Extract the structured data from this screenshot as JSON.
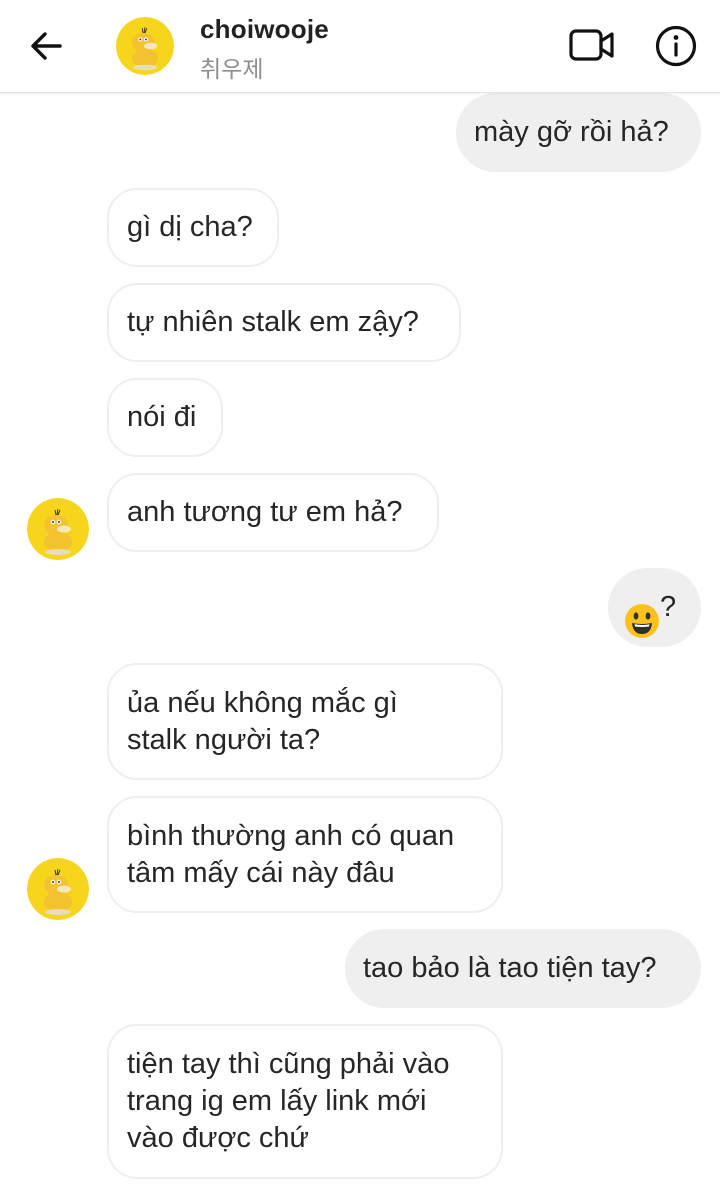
{
  "header": {
    "title": "choiwooje",
    "subtitle": "취우제",
    "back_icon": "arrow-left-icon",
    "video_icon": "video-camera-icon",
    "info_icon": "info-icon"
  },
  "messages": [
    {
      "side": "sent",
      "text": "mày gỡ rồi hả?"
    },
    {
      "side": "received",
      "text": "gì dị cha?"
    },
    {
      "side": "received",
      "text": "tự nhiên stalk em zậy?"
    },
    {
      "side": "received",
      "text": "nói đi"
    },
    {
      "side": "received",
      "text": "anh tương tư em hả?"
    },
    {
      "side": "sent",
      "emoji": "😃",
      "text": "?"
    },
    {
      "side": "received",
      "text": "ủa nếu không mắc gì\nstalk người ta?"
    },
    {
      "side": "received",
      "text": "bình thường anh có quan\ntâm mấy cái này đâu"
    },
    {
      "side": "sent",
      "text": "tao bảo là tao tiện tay?"
    },
    {
      "side": "received",
      "text": "tiện tay thì cũng phải vào\ntrang ig em lấy link mới\nvào được chứ"
    }
  ],
  "colors": {
    "avatar_bg": "#f7d51d",
    "sent_bubble": "#efefef",
    "received_border": "#efefef",
    "text": "#262626",
    "subtitle": "#8e8e8e"
  }
}
